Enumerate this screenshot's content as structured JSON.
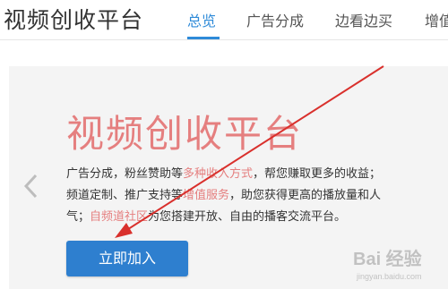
{
  "header": {
    "site_title": "视频创收平台",
    "nav": [
      {
        "label": "总览",
        "active": true
      },
      {
        "label": "广告分成",
        "active": false
      },
      {
        "label": "边看边买",
        "active": false
      },
      {
        "label": "增值",
        "active": false
      }
    ]
  },
  "banner": {
    "title": "视频创收平台",
    "desc": {
      "line1_a": "广告分成，粉丝赞助等",
      "line1_hl": "多种收入方式",
      "line1_b": "，帮您赚取更多的收益；",
      "line2_a": "频道定制、推广支持等",
      "line2_hl": "增值服务",
      "line2_b": "，助您获得更高的播放量和人",
      "line3_a": "气；",
      "line3_hl": "自频道社区",
      "line3_b": "为您搭建开放、自由的播客交流平台。"
    },
    "cta_label": "立即加入"
  },
  "watermark": {
    "text": "Bai 经验",
    "sub": "jingyan.baidu.com"
  },
  "colors": {
    "accent": "#2e8ad8",
    "highlight": "#e57f7f",
    "annotation": "#d9302c"
  },
  "icons": {
    "prev": "chevron-left-icon"
  }
}
